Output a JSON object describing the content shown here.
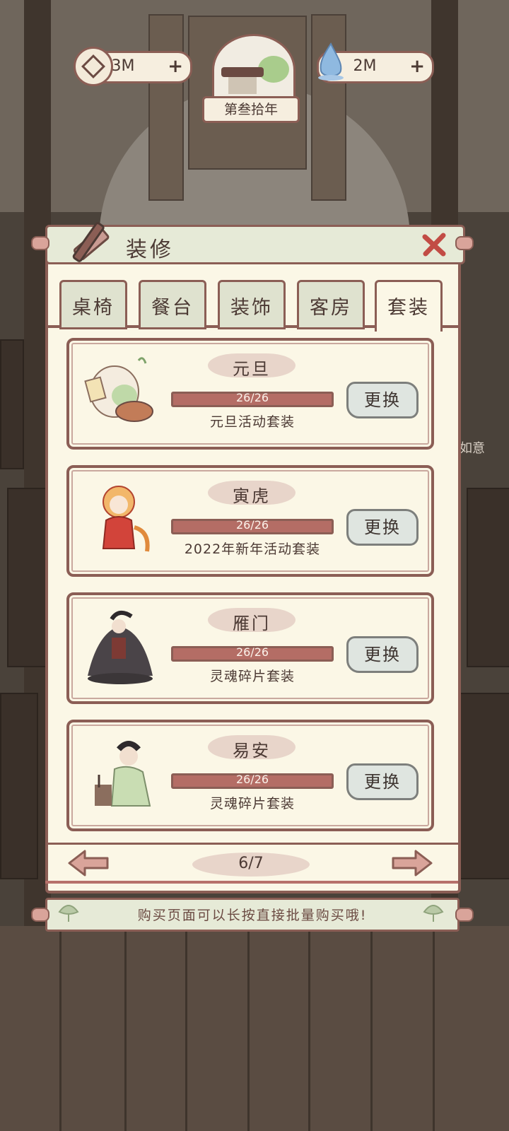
{
  "currency": {
    "coins": {
      "value": "3M",
      "plus": "+",
      "icon": "coin-icon"
    },
    "essence": {
      "value": "2M",
      "plus": "+",
      "icon": "water-drop-icon"
    }
  },
  "year": {
    "label": "第叁拾年",
    "icon": "pavilion-medallion-icon"
  },
  "panel": {
    "title": "装修",
    "title_icon": "hammer-icon",
    "close_icon": "close-icon"
  },
  "tabs": [
    {
      "label": "桌椅",
      "active": false
    },
    {
      "label": "餐台",
      "active": false
    },
    {
      "label": "装饰",
      "active": false
    },
    {
      "label": "客房",
      "active": false
    },
    {
      "label": "套装",
      "active": true
    }
  ],
  "sets": [
    {
      "name": "元旦",
      "progress": "26/26",
      "progress_fraction": 1.0,
      "desc": "元旦活动套装",
      "button": "更换",
      "portrait": "dumpling-character-portrait"
    },
    {
      "name": "寅虎",
      "progress": "26/26",
      "progress_fraction": 1.0,
      "desc": "2022年新年活动套装",
      "button": "更换",
      "portrait": "tiger-costume-girl-portrait"
    },
    {
      "name": "雁门",
      "progress": "26/26",
      "progress_fraction": 1.0,
      "desc": "灵魂碎片套装",
      "button": "更换",
      "portrait": "swordsman-portrait"
    },
    {
      "name": "易安",
      "progress": "26/26",
      "progress_fraction": 1.0,
      "desc": "灵魂碎片套装",
      "button": "更换",
      "portrait": "scholar-woman-portrait"
    }
  ],
  "pager": {
    "page": "6/7",
    "prev_icon": "arrow-left-icon",
    "next_icon": "arrow-right-icon"
  },
  "tip": "购买页面可以长按直接批量购买哦!",
  "background": {
    "side_label": "如意"
  },
  "colors": {
    "border": "#8b5e55",
    "panel": "#fbf7e6",
    "bar": "#b46d65",
    "header": "#e6ead7"
  }
}
